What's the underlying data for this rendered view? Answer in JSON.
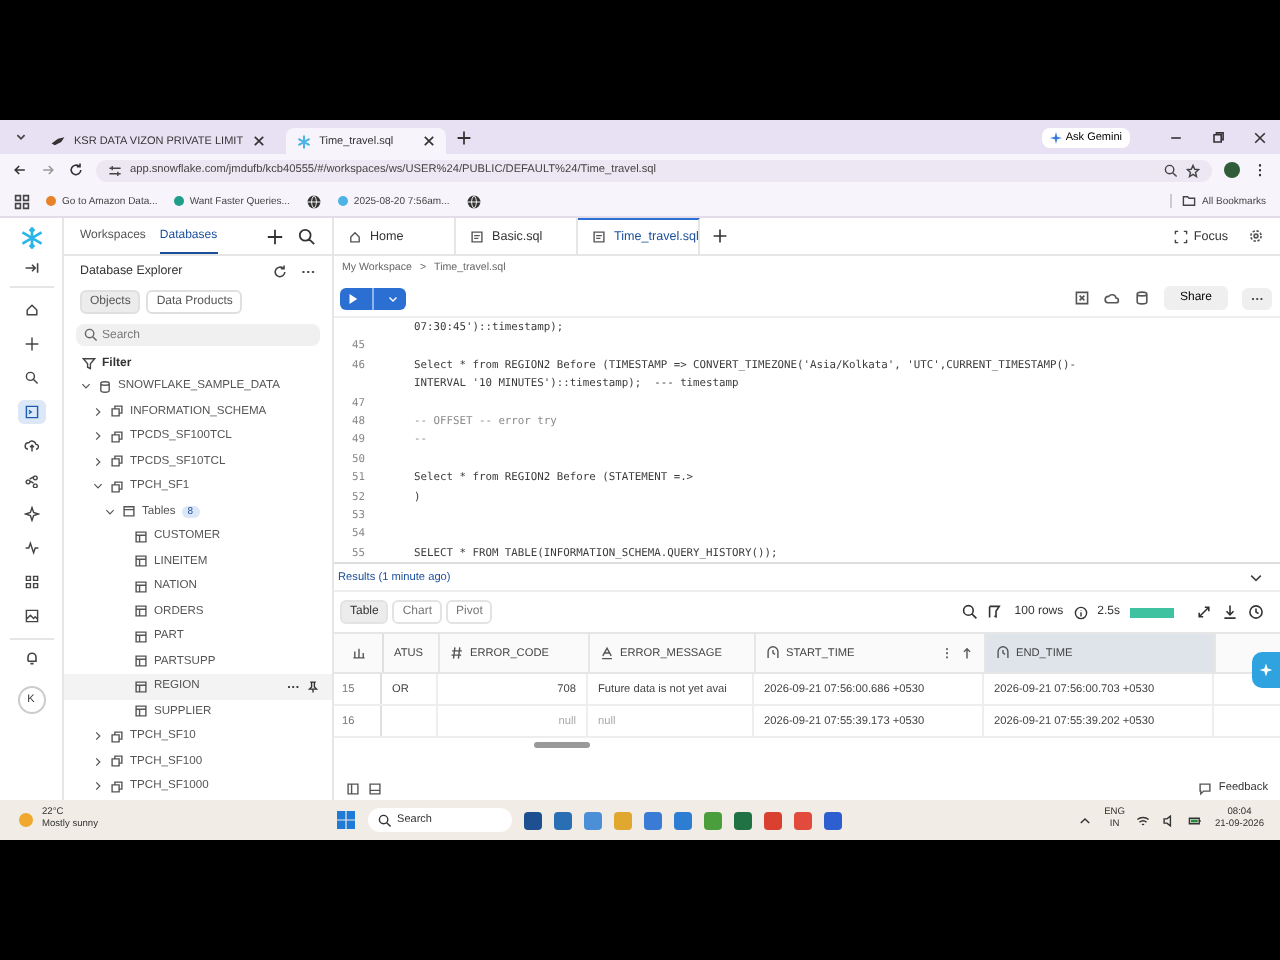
{
  "browser": {
    "tabs": [
      {
        "title": "KSR DATA VIZON PRIVATE LIMIT",
        "selected": false
      },
      {
        "title": "Time_travel.sql",
        "selected": true
      }
    ],
    "ask": "Ask Gemini",
    "address": "app.snowflake.com/jmdufb/kcb40555/#/workspaces/ws/USER%24/PUBLIC/DEFAULT%24/Time_travel.sql",
    "bookmarks": [
      {
        "title": "Go to Amazon Data...",
        "kind": "amazon"
      },
      {
        "title": "Want Faster Queries...",
        "kind": "teal"
      },
      {
        "kind": "globe"
      },
      {
        "title": "2025-08-20 7:56am...",
        "kind": "snow"
      },
      {
        "kind": "globe"
      }
    ],
    "all_bookmarks": "All Bookmarks"
  },
  "sidebar": {
    "tabs": [
      {
        "label": "Workspaces",
        "selected": false
      },
      {
        "label": "Databases",
        "selected": true
      }
    ],
    "rail": [
      {
        "selected": false
      },
      {
        "selected": false
      },
      {
        "selected": false
      },
      {
        "selected": true
      },
      {
        "selected": false
      },
      {
        "selected": false
      },
      {
        "selected": false
      },
      {
        "selected": false
      },
      {
        "selected": false
      },
      {
        "selected": false
      }
    ],
    "avatar": "K",
    "title": "Database Explorer",
    "subtabs": [
      {
        "label": "Objects",
        "selected": true
      },
      {
        "label": "Data Products",
        "selected": false
      }
    ],
    "search": {
      "placeholder": "Search"
    },
    "filter": "Filter",
    "tree": [
      {
        "label": "SNOWFLAKE_SAMPLE_DATA",
        "kind": "database",
        "expanded": true,
        "hovered": false,
        "children": [
          {
            "label": "INFORMATION_SCHEMA",
            "kind": "schema",
            "expanded": false,
            "hovered": false
          },
          {
            "label": "TPCDS_SF100TCL",
            "kind": "schema",
            "expanded": false,
            "hovered": false
          },
          {
            "label": "TPCDS_SF10TCL",
            "kind": "schema",
            "expanded": false,
            "hovered": false
          },
          {
            "label": "TPCH_SF1",
            "kind": "schema",
            "expanded": true,
            "hovered": false,
            "children": [
              {
                "label": "Tables",
                "kind": "folder",
                "badge": "8",
                "expanded": true,
                "hovered": false,
                "children": [
                  {
                    "label": "CUSTOMER",
                    "kind": "table",
                    "hovered": false
                  },
                  {
                    "label": "LINEITEM",
                    "kind": "table",
                    "hovered": false
                  },
                  {
                    "label": "NATION",
                    "kind": "table",
                    "hovered": false
                  },
                  {
                    "label": "ORDERS",
                    "kind": "table",
                    "hovered": false
                  },
                  {
                    "label": "PART",
                    "kind": "table",
                    "hovered": false
                  },
                  {
                    "label": "PARTSUPP",
                    "kind": "table",
                    "hovered": false
                  },
                  {
                    "label": "REGION",
                    "kind": "table",
                    "hovered": true
                  },
                  {
                    "label": "SUPPLIER",
                    "kind": "table",
                    "hovered": false
                  }
                ]
              }
            ]
          },
          {
            "label": "TPCH_SF10",
            "kind": "schema",
            "expanded": false,
            "hovered": false
          },
          {
            "label": "TPCH_SF100",
            "kind": "schema",
            "expanded": false,
            "hovered": false
          },
          {
            "label": "TPCH_SF1000",
            "kind": "schema",
            "expanded": false,
            "hovered": false
          }
        ]
      }
    ]
  },
  "editor": {
    "tabs": [
      {
        "label": "Home",
        "kind": "home",
        "selected": false
      },
      {
        "label": "Basic.sql",
        "kind": "sql",
        "selected": false
      },
      {
        "label": "Time_travel.sql",
        "kind": "sql",
        "selected": true
      }
    ],
    "focus": "Focus",
    "breadcrumb": [
      "My Workspace",
      ">",
      "Time_travel.sql"
    ],
    "share": "Share",
    "lines": [
      {
        "kind": "code",
        "text": [
          "07:30:45')::timestamp);"
        ]
      },
      {
        "number": "45"
      },
      {
        "number": "46",
        "kind": "code",
        "text": [
          "Select * from REGION2 Before (TIMESTAMP => CONVERT_TIMEZONE('Asia/Kolkata', 'UTC',CURRENT_TIMESTAMP()-",
          "INTERVAL '10 MINUTES')::timestamp);  --- timestamp"
        ]
      },
      {
        "number": "47"
      },
      {
        "number": "48",
        "kind": "comment",
        "text": [
          "-- OFFSET -- error try"
        ]
      },
      {
        "number": "49",
        "kind": "comment",
        "text": [
          "--"
        ]
      },
      {
        "number": "50"
      },
      {
        "number": "51",
        "kind": "code",
        "text": [
          "Select * from REGION2 Before (STATEMENT =.>"
        ]
      },
      {
        "number": "52",
        "kind": "code",
        "text": [
          ")"
        ]
      },
      {
        "number": "53"
      },
      {
        "number": "54"
      },
      {
        "number": "55",
        "kind": "code",
        "text": [
          "SELECT * FROM TABLE(INFORMATION_SCHEMA.QUERY_HISTORY());"
        ]
      }
    ]
  },
  "results": {
    "title": "Results (1 minute ago)",
    "views": [
      {
        "label": "Table",
        "selected": true
      },
      {
        "label": "Chart",
        "selected": false
      },
      {
        "label": "Pivot",
        "selected": false
      }
    ],
    "row_count": "100 rows",
    "duration": "2.5s",
    "columns": [
      {
        "name": "ATUS",
        "selected": false
      },
      {
        "name": "ERROR_CODE",
        "kind": "number",
        "selected": false
      },
      {
        "name": "ERROR_MESSAGE",
        "kind": "text",
        "selected": false
      },
      {
        "name": "START_TIME",
        "kind": "time",
        "selected": false
      },
      {
        "name": "END_TIME",
        "kind": "time",
        "selected": true
      }
    ],
    "rows": [
      {
        "number": "15",
        "cells": [
          {
            "text": "OR",
            "null": false
          },
          {
            "text": "708",
            "null": false
          },
          {
            "text": "Future data is not yet avai",
            "null": false
          },
          {
            "text": "2026-09-21 07:56:00.686 +0530",
            "null": false
          },
          {
            "text": "2026-09-21 07:56:00.703 +0530",
            "null": false
          }
        ]
      },
      {
        "number": "16",
        "cells": [
          null,
          {
            "text": "null",
            "null": true
          },
          {
            "text": "null",
            "null": true
          },
          {
            "text": "2026-09-21 07:55:39.173 +0530",
            "null": false
          },
          {
            "text": "2026-09-21 07:55:39.202 +0530",
            "null": false
          }
        ]
      }
    ],
    "feedback": "Feedback"
  },
  "taskbar": {
    "temperature": "22°C",
    "weather": "Mostly sunny",
    "search": "Search",
    "language": "ENG",
    "region": "IN",
    "time": "08:04",
    "date": "21-09-2026"
  }
}
